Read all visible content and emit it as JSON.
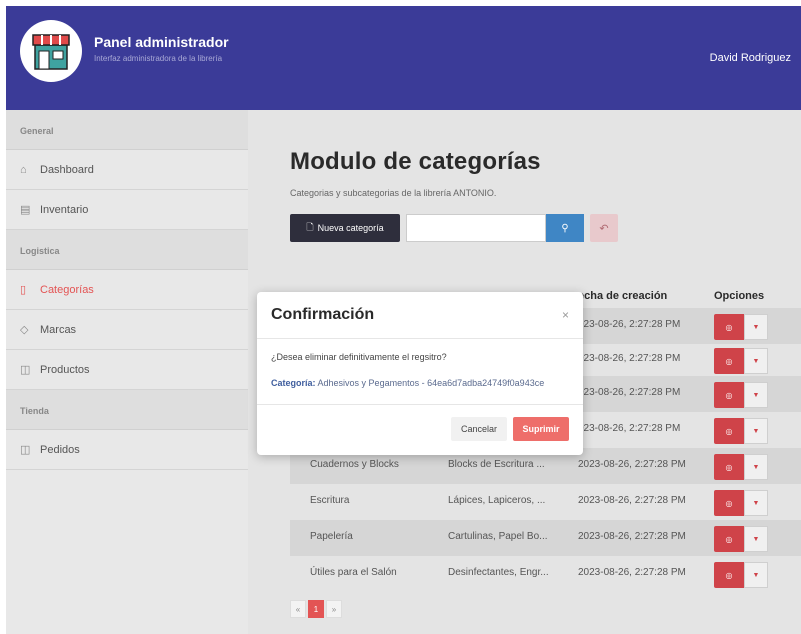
{
  "header": {
    "title": "Panel administrador",
    "subtitle": "Interfaz administradora de la librería",
    "user": "David Rodriguez",
    "accent": "#3b3b98"
  },
  "sidebar": {
    "sections": [
      {
        "label": "General"
      },
      {
        "label": "Logistica"
      },
      {
        "label": "Tienda"
      }
    ],
    "items": [
      {
        "label": "Dashboard",
        "icon": "home-icon"
      },
      {
        "label": "Inventario",
        "icon": "inventory-icon"
      },
      {
        "label": "Categorías",
        "icon": "bookmark-icon",
        "active": true
      },
      {
        "label": "Marcas",
        "icon": "tag-icon"
      },
      {
        "label": "Productos",
        "icon": "box-icon"
      },
      {
        "label": "Pedidos",
        "icon": "box-icon"
      }
    ]
  },
  "main": {
    "title": "Modulo de categorías",
    "subtitle": "Categorias y subcategorias de la librería ANTONIO.",
    "new_button": "Nueva categoría",
    "search_placeholder": "",
    "table": {
      "headers": {
        "date": "echa de creación",
        "options": "Opciones"
      },
      "rows": [
        {
          "name": "",
          "sub": "",
          "date": "023-08-26, 2:27:28 PM"
        },
        {
          "name": "",
          "sub": "",
          "date": "023-08-26, 2:27:28 PM"
        },
        {
          "name": "",
          "sub": "",
          "date": "023-08-26, 2:27:28 PM"
        },
        {
          "name": "",
          "sub": "",
          "date": "023-08-26, 2:27:28 PM"
        },
        {
          "name": "Cuadernos y Blocks",
          "sub": "Blocks de Escritura ...",
          "date": "2023-08-26, 2:27:28 PM"
        },
        {
          "name": "Escritura",
          "sub": "Lápices, Lapiceros, ...",
          "date": "2023-08-26, 2:27:28 PM"
        },
        {
          "name": "Papelería",
          "sub": "Cartulinas, Papel Bo...",
          "date": "2023-08-26, 2:27:28 PM"
        },
        {
          "name": "Útiles para el Salón",
          "sub": "Desinfectantes, Engr...",
          "date": "2023-08-26, 2:27:28 PM"
        }
      ]
    },
    "pager": {
      "prev": "«",
      "current": "1",
      "next": "»"
    }
  },
  "modal": {
    "title": "Confirmación",
    "close": "×",
    "question": "¿Desea eliminar definitivamente el regsitro?",
    "category_label": "Categoría:",
    "category_value": "Adhesivos y Pegamentos - 64ea6d7adba24749f0a943ce",
    "cancel": "Cancelar",
    "delete": "Suprimir"
  }
}
